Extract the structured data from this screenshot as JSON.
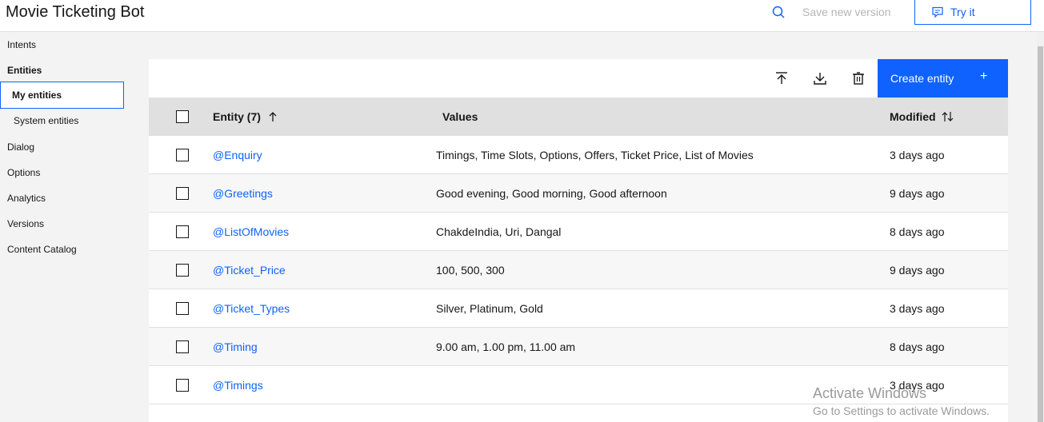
{
  "header": {
    "title": "Movie Ticketing Bot",
    "save_label": "Save new version",
    "try_label": "Try it"
  },
  "sidebar": {
    "items": [
      {
        "label": "Intents"
      },
      {
        "label": "Entities"
      },
      {
        "label": "My entities"
      },
      {
        "label": "System entities"
      },
      {
        "label": "Dialog"
      },
      {
        "label": "Options"
      },
      {
        "label": "Analytics"
      },
      {
        "label": "Versions"
      },
      {
        "label": "Content Catalog"
      }
    ]
  },
  "toolbar": {
    "create_label": "Create entity",
    "icons": [
      "upload-icon",
      "download-icon",
      "trash-icon",
      "plus-icon"
    ]
  },
  "table": {
    "columns": {
      "entity": "Entity (7)",
      "values": "Values",
      "modified": "Modified"
    },
    "rows": [
      {
        "name": "@Enquiry",
        "values": "Timings, Time Slots, Options, Offers, Ticket Price, List of Movies",
        "modified": "3 days ago"
      },
      {
        "name": "@Greetings",
        "values": "Good evening, Good morning, Good afternoon",
        "modified": "9 days ago"
      },
      {
        "name": "@ListOfMovies",
        "values": "ChakdeIndia, Uri, Dangal",
        "modified": "8 days ago"
      },
      {
        "name": "@Ticket_Price",
        "values": "100, 500, 300",
        "modified": "9 days ago"
      },
      {
        "name": "@Ticket_Types",
        "values": "Silver, Platinum, Gold",
        "modified": "3 days ago"
      },
      {
        "name": "@Timing",
        "values": "9.00 am, 1.00 pm, 11.00 am",
        "modified": "8 days ago"
      },
      {
        "name": "@Timings",
        "values": "",
        "modified": "3 days ago"
      }
    ]
  },
  "watermark": {
    "line1": "Activate Windows",
    "line2": "Go to Settings to activate Windows."
  },
  "colors": {
    "accent": "#0f62fe",
    "header_bg": "#e0e0e0"
  }
}
